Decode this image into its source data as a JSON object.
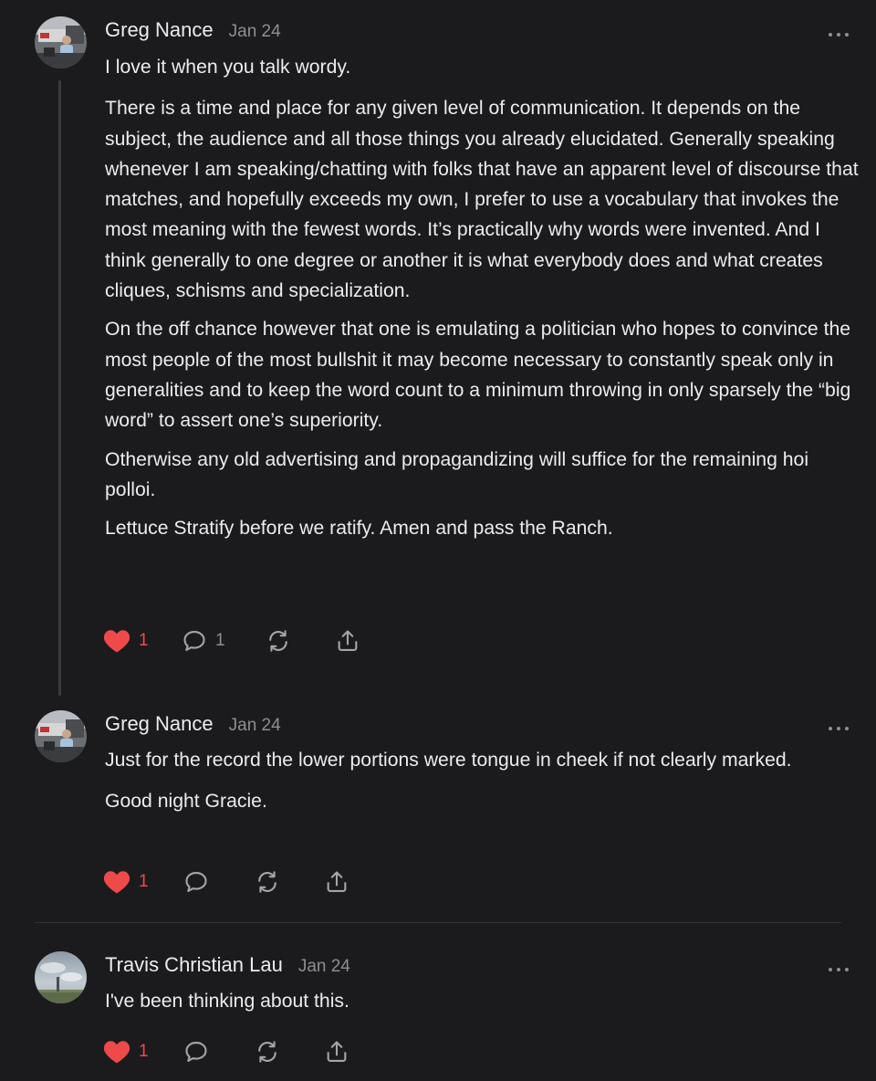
{
  "comments": [
    {
      "author": "Greg Nance",
      "date": "Jan 24",
      "paragraphs": [
        "I love it when you talk wordy.",
        "There is a time and place for any given level of communication. It depends on the subject, the audience and all those things you already elucidated. Generally speaking whenever I am speaking/chatting with folks that have an apparent level of discourse that matches, and hopefully exceeds my own, I prefer to use a vocabulary that invokes the most meaning with the fewest words. It’s practically why words were invented. And I think generally to one degree or another it is what everybody does and what creates cliques, schisms and specialization.",
        "On the off chance however that one is emulating a politician who hopes to convince the most people of the most bullshit it may become necessary to constantly speak only in generalities and to keep the word count to a minimum throwing in only sparsely the “big word” to assert one’s superiority.",
        "Otherwise any old advertising and propagandizing will suffice for the remaining hoi polloi.",
        "Lettuce Stratify before we ratify. Amen and pass the Ranch."
      ],
      "likes": "1",
      "replies": "1",
      "avatar_icon": "person-photo-avatar"
    },
    {
      "author": "Greg Nance",
      "date": "Jan 24",
      "paragraphs": [
        "Just for the record the lower portions were tongue in cheek if not clearly marked.",
        "Good night Gracie."
      ],
      "likes": "1",
      "replies": "",
      "avatar_icon": "person-photo-avatar"
    },
    {
      "author": "Travis Christian Lau",
      "date": "Jan 24",
      "paragraphs": [
        "I've been thinking about this."
      ],
      "likes": "1",
      "replies": "",
      "avatar_icon": "sky-landscape-avatar"
    }
  ],
  "icons": {
    "like": "heart-icon",
    "reply": "speech-bubble-icon",
    "restack": "restack-arrows-icon",
    "share": "share-upload-icon",
    "more": "more-dots-icon"
  },
  "colors": {
    "background": "#1b1b1d",
    "text": "#ececee",
    "muted": "#8e8e93",
    "like": "#ef4a4a",
    "thread_line": "#3b3b3e"
  }
}
